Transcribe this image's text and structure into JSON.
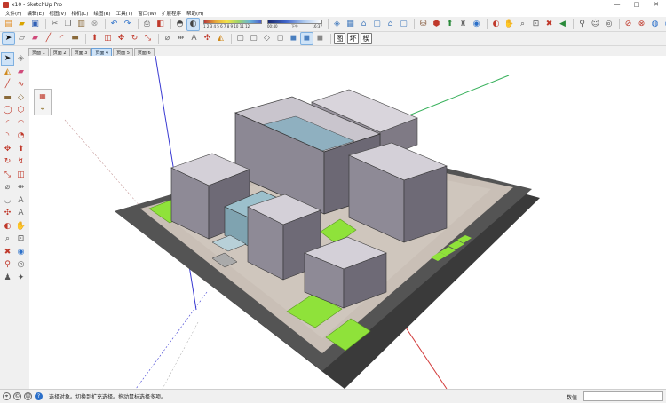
{
  "window": {
    "title": "x10 - SketchUp Pro",
    "controls": {
      "minimize": "—",
      "maximize": "□",
      "close": "✕"
    }
  },
  "menu": [
    "文件(F)",
    "编辑(E)",
    "视图(V)",
    "相机(C)",
    "绘图(R)",
    "工具(T)",
    "窗口(W)",
    "扩展程序",
    "帮助(H)"
  ],
  "toolbar1": {
    "scale_a_ticks": "1 2 3 4 5 6 7 8 9 10 11 12",
    "scale_b_left": "00:40",
    "scale_b_mid": "下午",
    "scale_b_right": "16:37"
  },
  "toolbar2": {
    "section_labels": [
      "图",
      "坏",
      "楔"
    ]
  },
  "scenes": {
    "tabs": [
      "页面 1",
      "页面 2",
      "页面 3",
      "页面 4",
      "页面 5",
      "页面 6"
    ],
    "active": "页面 4"
  },
  "statusbar": {
    "hint": "选择对象。切换到扩充选择。拖动鼠标选择多项。",
    "measurements_label": "数值",
    "measurements_value": ""
  },
  "colors": {
    "accent": "#cfe3f7",
    "ground": "#c9bfb6",
    "road": "#545454",
    "lawn": "#8fe23a",
    "axis_red": "#d23a3a",
    "axis_green": "#36b05a",
    "axis_blue": "#3a3ad2"
  }
}
